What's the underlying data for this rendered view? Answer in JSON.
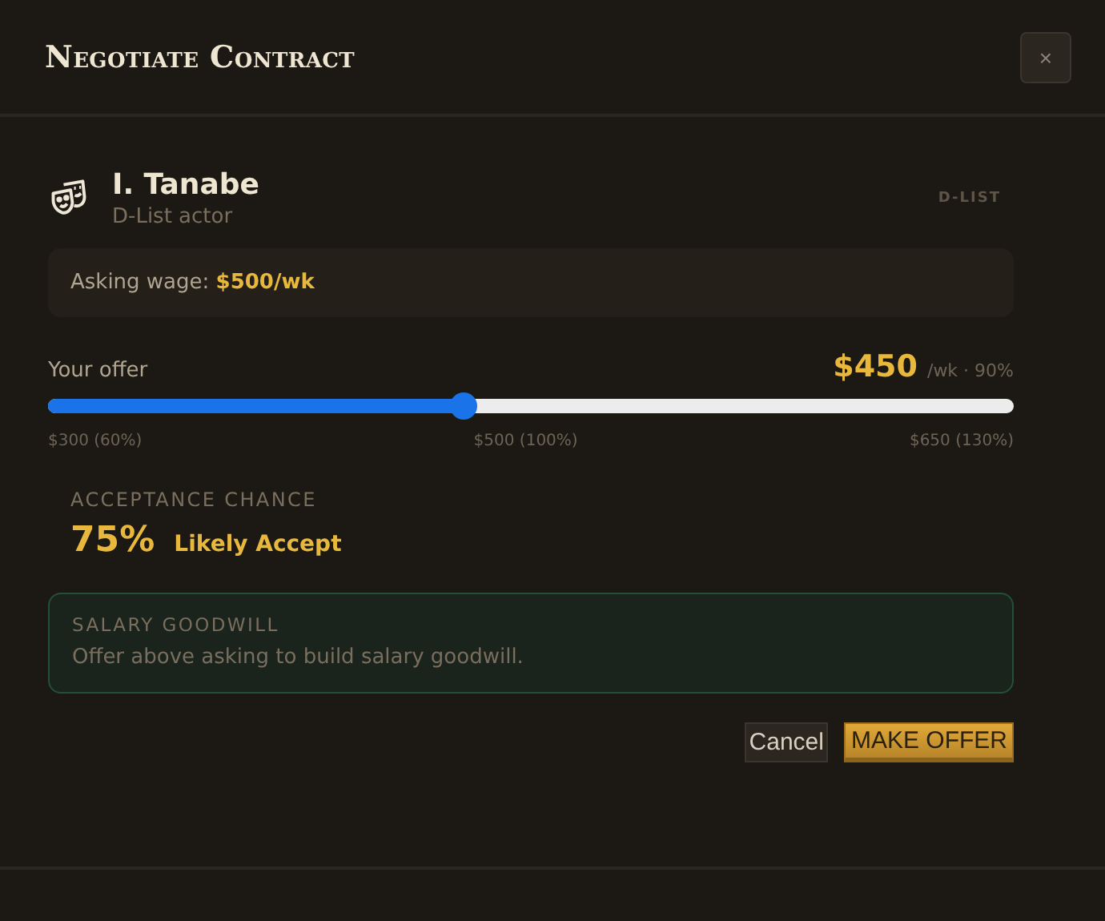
{
  "dialog": {
    "title": "Negotiate Contract",
    "close": "×"
  },
  "person": {
    "name": "I. Tanabe",
    "role": "D-List actor",
    "tier": "D-LIST"
  },
  "asking": {
    "label": "Asking wage:",
    "value": "$500/wk"
  },
  "offer": {
    "label": "Your offer",
    "amount": "$450",
    "unit": "/wk · 90%",
    "level": 0.43,
    "ticks": [
      "$300 (60%)",
      "$500 (100%)",
      "$650 (130%)"
    ]
  },
  "acceptance": {
    "caption": "ACCEPTANCE CHANCE",
    "percent": "75%",
    "verdict": "Likely Accept"
  },
  "goodwill": {
    "caption": "SALARY GOODWILL",
    "text": "Offer above asking to build salary goodwill."
  },
  "buttons": [
    {
      "label": "Cancel",
      "kind": "plain"
    },
    {
      "label": "MAKE OFFER",
      "kind": "primary"
    }
  ]
}
